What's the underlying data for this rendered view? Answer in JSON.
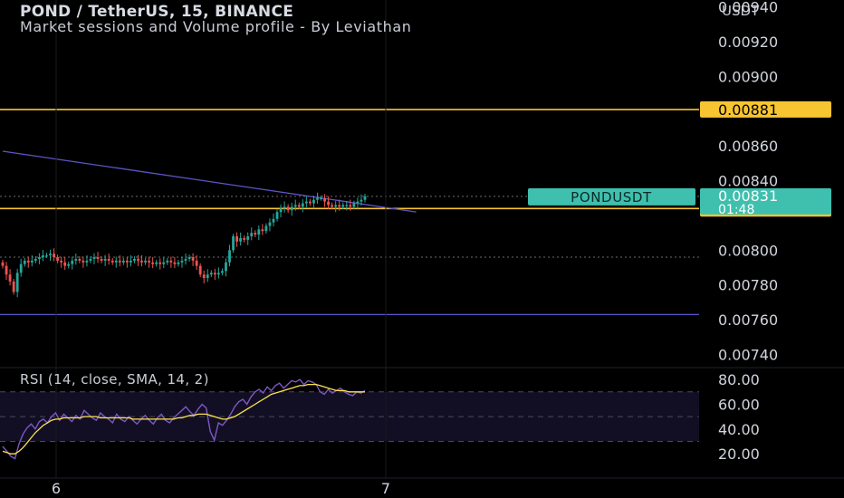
{
  "header": {
    "title": "POND / TetherUS, 15, BINANCE",
    "subtitle": "Market sessions and Volume profile - By Leviathan",
    "currency": "USDT"
  },
  "rsi_label": "RSI (14, close, SMA, 14, 2)",
  "colors": {
    "background": "#000000",
    "up": "#26a69a",
    "down": "#ef5350",
    "level": "#f7c531",
    "trendline": "#5d55c8",
    "rsi": "#7e57c2",
    "rsi_ma": "#ffe34d",
    "ticker_badge": "#3fbfae"
  },
  "chart_data": [
    {
      "type": "candlestick",
      "symbol": "PONDUSDT",
      "interval": "15",
      "exchange": "BINANCE",
      "ylim": [
        0.00734,
        0.00944
      ],
      "y_ticks": [
        "0.00940",
        "0.00920",
        "0.00900",
        "0.00860",
        "0.00840",
        "0.00800",
        "0.00780",
        "0.00760",
        "0.00740"
      ],
      "x_ticks": [
        "6",
        "7"
      ],
      "grid": false,
      "last_price": "0.00831",
      "countdown": "01:48",
      "horizontal_levels": [
        {
          "label": "0.00881",
          "value": 0.00881
        },
        {
          "label": "0.00824",
          "value": 0.00824
        },
        {
          "value": 0.00763
        }
      ],
      "dotted_levels": [
        0.00831,
        0.00796
      ],
      "trendline": [
        {
          "x": 0,
          "y": 0.00857
        },
        {
          "x": 113,
          "y": 0.00822
        }
      ],
      "close": [
        0.00791,
        0.00786,
        0.00782,
        0.00776,
        0.00787,
        0.00792,
        0.00794,
        0.00793,
        0.00794,
        0.00795,
        0.00796,
        0.00797,
        0.00797,
        0.00798,
        0.00796,
        0.00794,
        0.00793,
        0.00791,
        0.00792,
        0.00794,
        0.00795,
        0.00794,
        0.00793,
        0.00794,
        0.00795,
        0.00796,
        0.00795,
        0.00794,
        0.00795,
        0.00794,
        0.00793,
        0.00794,
        0.00793,
        0.00794,
        0.00793,
        0.00794,
        0.00795,
        0.00794,
        0.00793,
        0.00794,
        0.00793,
        0.00792,
        0.00793,
        0.00792,
        0.00793,
        0.00794,
        0.00793,
        0.00792,
        0.00793,
        0.00794,
        0.00795,
        0.00796,
        0.00794,
        0.00791,
        0.00786,
        0.00784,
        0.00786,
        0.00787,
        0.00786,
        0.00787,
        0.00788,
        0.00793,
        0.008,
        0.00808,
        0.00805,
        0.00807,
        0.00806,
        0.00808,
        0.0081,
        0.00809,
        0.00812,
        0.00811,
        0.00814,
        0.00816,
        0.00818,
        0.00822,
        0.00824,
        0.00825,
        0.00823,
        0.00825,
        0.00826,
        0.00825,
        0.00827,
        0.00828,
        0.00827,
        0.00829,
        0.0083,
        0.0083,
        0.00828,
        0.00826,
        0.00825,
        0.00826,
        0.00825,
        0.00826,
        0.00826,
        0.00825,
        0.00827,
        0.00828,
        0.00829,
        0.00831
      ]
    },
    {
      "type": "line",
      "title": "RSI (14, close, SMA, 14, 2)",
      "ylim": [
        15,
        83
      ],
      "y_ticks": [
        "80.00",
        "60.00",
        "40.00",
        "20.00"
      ],
      "bands": [
        70,
        50,
        30
      ],
      "series": [
        {
          "name": "RSI",
          "values": [
            26,
            22,
            18,
            16,
            28,
            36,
            41,
            44,
            40,
            46,
            48,
            45,
            50,
            53,
            47,
            52,
            49,
            46,
            51,
            48,
            55,
            52,
            49,
            47,
            53,
            50,
            48,
            45,
            52,
            48,
            46,
            50,
            47,
            44,
            48,
            51,
            47,
            44,
            49,
            52,
            47,
            45,
            49,
            52,
            55,
            58,
            54,
            51,
            56,
            60,
            57,
            38,
            31,
            45,
            43,
            47,
            52,
            58,
            62,
            64,
            60,
            66,
            70,
            72,
            69,
            74,
            71,
            75,
            77,
            73,
            76,
            79,
            78,
            80,
            76,
            79,
            78,
            76,
            70,
            68,
            72,
            69,
            71,
            73,
            70,
            68,
            67,
            70,
            69,
            71
          ]
        },
        {
          "name": "RSI-based MA",
          "values": [
            22,
            21,
            20,
            20,
            22,
            25,
            29,
            33,
            37,
            40,
            43,
            45,
            47,
            48,
            48,
            49,
            49,
            49,
            49,
            49,
            50,
            50,
            50,
            50,
            49,
            49,
            49,
            49,
            49,
            49,
            49,
            49,
            48,
            48,
            48,
            48,
            48,
            48,
            48,
            48,
            48,
            48,
            48,
            49,
            49,
            50,
            51,
            51,
            52,
            52,
            52,
            51,
            50,
            49,
            48,
            48,
            49,
            50,
            52,
            54,
            56,
            58,
            60,
            62,
            64,
            66,
            68,
            69,
            70,
            71,
            72,
            73,
            74,
            75,
            75,
            76,
            76,
            76,
            75,
            74,
            73,
            72,
            71,
            71,
            71,
            70,
            70,
            70,
            70,
            70
          ]
        }
      ]
    }
  ]
}
